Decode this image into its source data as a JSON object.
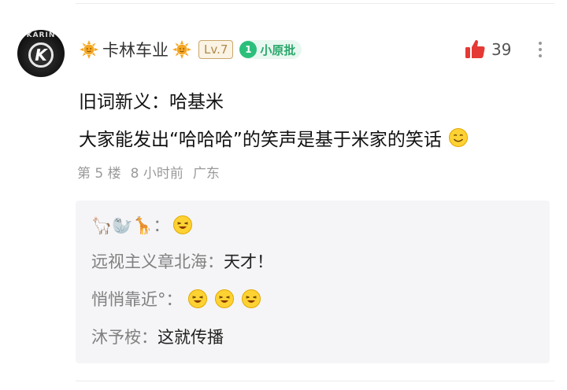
{
  "post": {
    "avatar_text": "KARIN",
    "avatar_letter": "K",
    "username": "卡林车业",
    "level": "Lv.7",
    "fan_level": "1",
    "fan_badge": "小原批",
    "like_count": "39",
    "line1": "旧词新义：哈基米",
    "line2": "大家能发出“哈哈哈”的笑声是基于米家的笑话",
    "meta": {
      "floor": "第 5 楼",
      "time": "8 小时前",
      "location": "广东"
    }
  },
  "replies": [
    {
      "name": "🦙🦭🦒：",
      "text": "",
      "emoji_count": 1
    },
    {
      "name": "远视主义章北海：",
      "text": "天才！",
      "emoji_count": 0
    },
    {
      "name": "悄悄靠近°：",
      "text": "",
      "emoji_count": 3
    },
    {
      "name": "沐予桉：",
      "text": "这就传播",
      "emoji_count": 0
    }
  ],
  "colors": {
    "like": "#e53935",
    "fan_badge": "#2aa86c",
    "level_badge": "#b08a4a",
    "reply_name": "#808080"
  },
  "icons": {
    "sun": "sun-icon",
    "like": "thumbs-up-icon",
    "more": "more-vertical-icon",
    "smile": "smile-emoji-icon",
    "laugh": "laugh-emoji-icon"
  }
}
